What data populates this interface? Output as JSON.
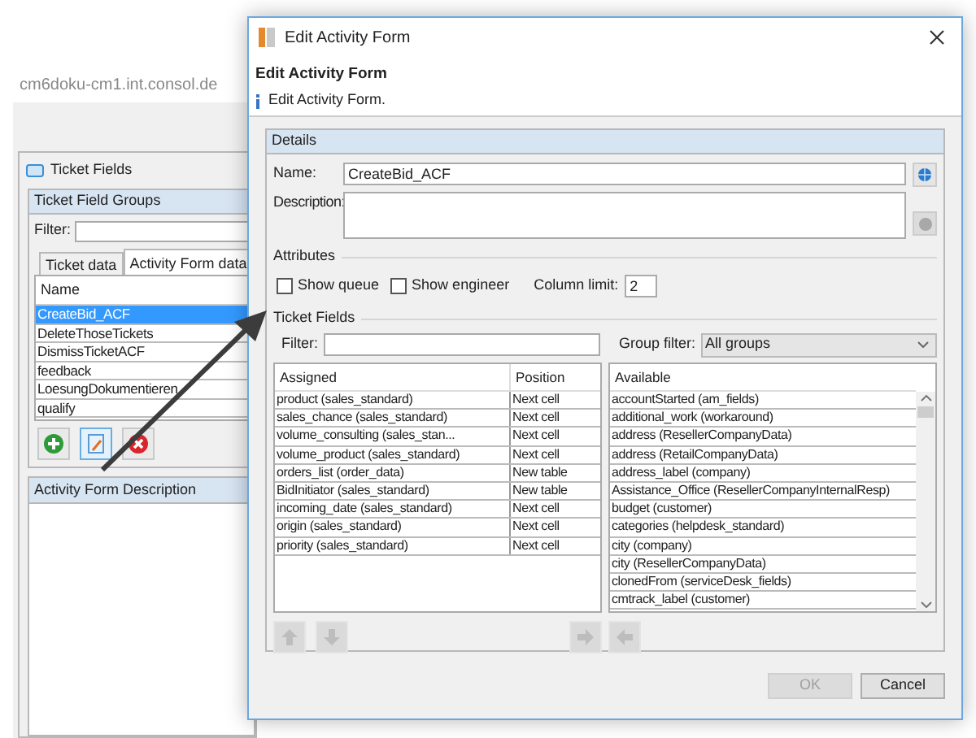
{
  "background_window": {
    "address": "cm6doku-cm1.int.consol.de",
    "panel_title": "Ticket Fields",
    "groups_title": "Ticket Field Groups",
    "filter_label": "Filter:",
    "tabs": [
      {
        "label": "Ticket data",
        "selected": false
      },
      {
        "label": "Activity Form data",
        "selected": true
      }
    ],
    "list_header": "Name",
    "list_items": [
      {
        "label": "CreateBid_ACF",
        "selected": true
      },
      {
        "label": "DeleteThoseTickets",
        "selected": false
      },
      {
        "label": "DismissTicketACF",
        "selected": false
      },
      {
        "label": "feedback",
        "selected": false
      },
      {
        "label": "LoesungDokumentieren",
        "selected": false
      },
      {
        "label": "qualify",
        "selected": false
      }
    ],
    "description_title": "Activity Form Description"
  },
  "dialog": {
    "title": "Edit Activity Form",
    "heading": "Edit Activity Form",
    "info": "Edit Activity Form.",
    "details_title": "Details",
    "name_label": "Name:",
    "name_value": "CreateBid_ACF",
    "description_label": "Description:",
    "attributes_title": "Attributes",
    "checkboxes": [
      {
        "label": "Show queue",
        "checked": false
      },
      {
        "label": "Show engineer",
        "checked": false
      }
    ],
    "column_limit_label": "Column limit:",
    "column_limit_value": "2",
    "ticket_fields_title": "Ticket Fields",
    "filter_label": "Filter:",
    "group_filter_label": "Group filter:",
    "group_filter_value": "All groups",
    "assigned_columns": [
      "Assigned",
      "Position"
    ],
    "assigned_rows": [
      [
        "product (sales_standard)",
        "Next cell"
      ],
      [
        "sales_chance (sales_standard)",
        "Next cell"
      ],
      [
        "volume_consulting (sales_stan...",
        "Next cell"
      ],
      [
        "volume_product (sales_standard)",
        "Next cell"
      ],
      [
        "orders_list (order_data)",
        "New table"
      ],
      [
        "BidInitiator (sales_standard)",
        "New table"
      ],
      [
        "incoming_date (sales_standard)",
        "Next cell"
      ],
      [
        "origin (sales_standard)",
        "Next cell"
      ],
      [
        "priority (sales_standard)",
        "Next cell"
      ]
    ],
    "available_header": "Available",
    "available_rows": [
      "accountStarted (am_fields)",
      "additional_work (workaround)",
      "address (ResellerCompanyData)",
      "address (RetailCompanyData)",
      "address_label (company)",
      "Assistance_Office (ResellerCompanyInternalResp)",
      "budget (customer)",
      "categories (helpdesk_standard)",
      "city (company)",
      "city (ResellerCompanyData)",
      "clonedFrom (serviceDesk_fields)",
      "cmtrack_label (customer)"
    ],
    "buttons": [
      {
        "label": "OK",
        "disabled": true
      },
      {
        "label": "Cancel",
        "disabled": false
      }
    ]
  }
}
